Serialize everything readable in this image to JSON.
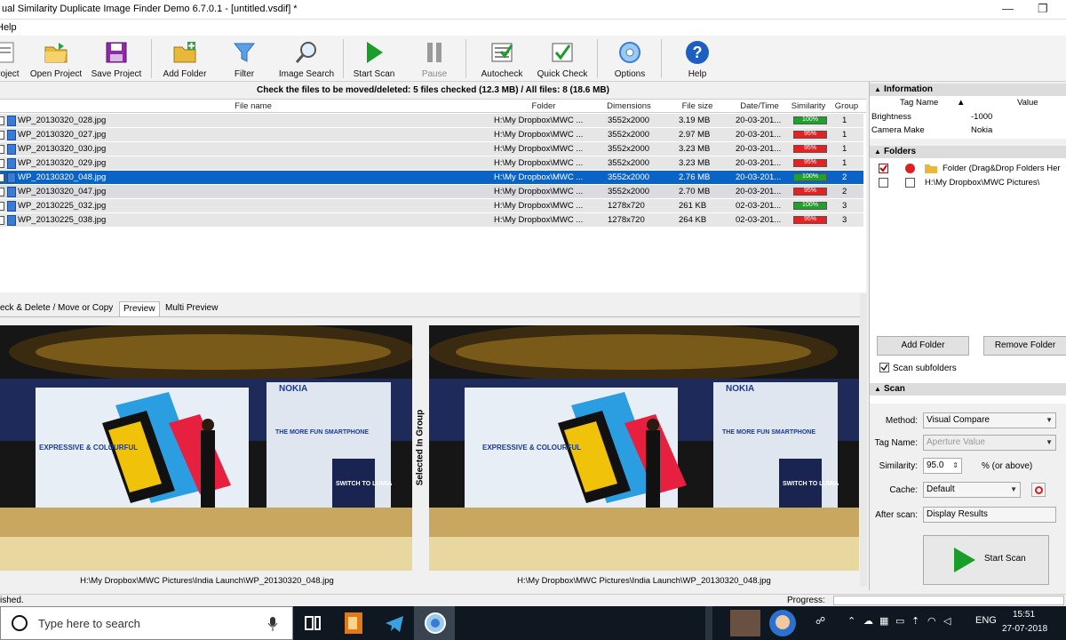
{
  "window": {
    "title": "ual Similarity Duplicate Image Finder Demo 6.7.0.1 - [untitled.vsdif] *",
    "min": "—",
    "max": "❐"
  },
  "menu": {
    "help": "Help"
  },
  "toolbar": {
    "items": [
      {
        "label": "Project",
        "icon": "new-project-icon"
      },
      {
        "label": "Open Project",
        "icon": "open-folder-icon"
      },
      {
        "label": "Save Project",
        "icon": "save-disk-icon"
      },
      {
        "label": "Add Folder",
        "icon": "add-folder-icon"
      },
      {
        "label": "Filter",
        "icon": "funnel-icon"
      },
      {
        "label": "Image Search",
        "icon": "magnifier-icon"
      },
      {
        "label": "Start Scan",
        "icon": "play-icon"
      },
      {
        "label": "Pause",
        "icon": "pause-icon"
      },
      {
        "label": "Autocheck",
        "icon": "autocheck-icon"
      },
      {
        "label": "Quick Check",
        "icon": "quick-check-icon"
      },
      {
        "label": "Options",
        "icon": "gear-icon"
      },
      {
        "label": "Help",
        "icon": "help-icon"
      }
    ]
  },
  "summary": "Check the files to be moved/deleted: 5 files checked (12.3 MB) / All files: 8 (18.6 MB)",
  "grid": {
    "headers": {
      "name": "File name",
      "folder": "Folder",
      "dims": "Dimensions",
      "size": "File size",
      "date": "Date/Time",
      "sim": "Similarity",
      "group": "Group"
    },
    "rows": [
      {
        "name": "WP_20130320_028.jpg",
        "folder": "H:\\My Dropbox\\MWC ...",
        "dims": "3552x2000",
        "size": "3.19 MB",
        "date": "20-03-201...",
        "sim": "100%",
        "simc": "g",
        "group": "1"
      },
      {
        "name": "WP_20130320_027.jpg",
        "folder": "H:\\My Dropbox\\MWC ...",
        "dims": "3552x2000",
        "size": "2.97 MB",
        "date": "20-03-201...",
        "sim": "95%",
        "simc": "r",
        "group": "1"
      },
      {
        "name": "WP_20130320_030.jpg",
        "folder": "H:\\My Dropbox\\MWC ...",
        "dims": "3552x2000",
        "size": "3.23 MB",
        "date": "20-03-201...",
        "sim": "95%",
        "simc": "r",
        "group": "1"
      },
      {
        "name": "WP_20130320_029.jpg",
        "folder": "H:\\My Dropbox\\MWC ...",
        "dims": "3552x2000",
        "size": "3.23 MB",
        "date": "20-03-201...",
        "sim": "95%",
        "simc": "r",
        "group": "1"
      },
      {
        "name": "WP_20130320_048.jpg",
        "folder": "H:\\My Dropbox\\MWC ...",
        "dims": "3552x2000",
        "size": "2.76 MB",
        "date": "20-03-201...",
        "sim": "100%",
        "simc": "g",
        "group": "2"
      },
      {
        "name": "WP_20130320_047.jpg",
        "folder": "H:\\My Dropbox\\MWC ...",
        "dims": "3552x2000",
        "size": "2.70 MB",
        "date": "20-03-201...",
        "sim": "95%",
        "simc": "r",
        "group": "2"
      },
      {
        "name": "WP_20130225_032.jpg",
        "folder": "H:\\My Dropbox\\MWC ...",
        "dims": "1278x720",
        "size": "261 KB",
        "date": "02-03-201...",
        "sim": "100%",
        "simc": "g",
        "group": "3"
      },
      {
        "name": "WP_20130225_038.jpg",
        "folder": "H:\\My Dropbox\\MWC ...",
        "dims": "1278x720",
        "size": "264 KB",
        "date": "02-03-201...",
        "sim": "95%",
        "simc": "r",
        "group": "3"
      }
    ],
    "selected_index": 4
  },
  "tabs": [
    "eck & Delete / Move or Copy",
    "Preview",
    "Multi Preview"
  ],
  "preview": {
    "left_path": "H:\\My Dropbox\\MWC Pictures\\India Launch\\WP_20130320_048.jpg",
    "right_path": "H:\\My Dropbox\\MWC Pictures\\India Launch\\WP_20130320_048.jpg",
    "vertical_label": "Selected In Group",
    "banner_left": "EXPRESSIVE & COLOURFUL",
    "banner_brand": "NOKIA",
    "banner_right": "THE MORE FUN SMARTPHONE",
    "banner_switch": "SWITCH TO LUMIA"
  },
  "status": {
    "left": "ished.",
    "progress": "Progress:"
  },
  "taskbar": {
    "search": "Type here to search",
    "lang": "ENG",
    "time": "15:51",
    "date": "27-07-2018"
  },
  "right": {
    "information": "Information",
    "tag_name": "Tag Name",
    "value": "Value",
    "info_rows": [
      {
        "k": "Brightness",
        "v": "-1000"
      },
      {
        "k": "Camera Make",
        "v": "Nokia"
      }
    ],
    "folders": "Folders",
    "folder_rows": [
      "Folder (Drag&Drop Folders Her",
      "H:\\My Dropbox\\MWC Pictures\\"
    ],
    "add_folder": "Add Folder",
    "remove_folder": "Remove Folder",
    "scan_sub": "Scan subfolders",
    "scan": "Scan",
    "method_l": "Method:",
    "method_v": "Visual Compare",
    "tag_l": "Tag Name:",
    "tag_v": "Aperture Value",
    "sim_l": "Similarity:",
    "sim_v": "95.0",
    "sim_unit": "% (or above)",
    "cache_l": "Cache:",
    "cache_v": "Default",
    "after_l": "After scan:",
    "after_v": "Display Results",
    "start_scan": "Start Scan"
  },
  "colors": {
    "select": "#0a64c8",
    "green": "#1fa12b",
    "red": "#e82020"
  }
}
